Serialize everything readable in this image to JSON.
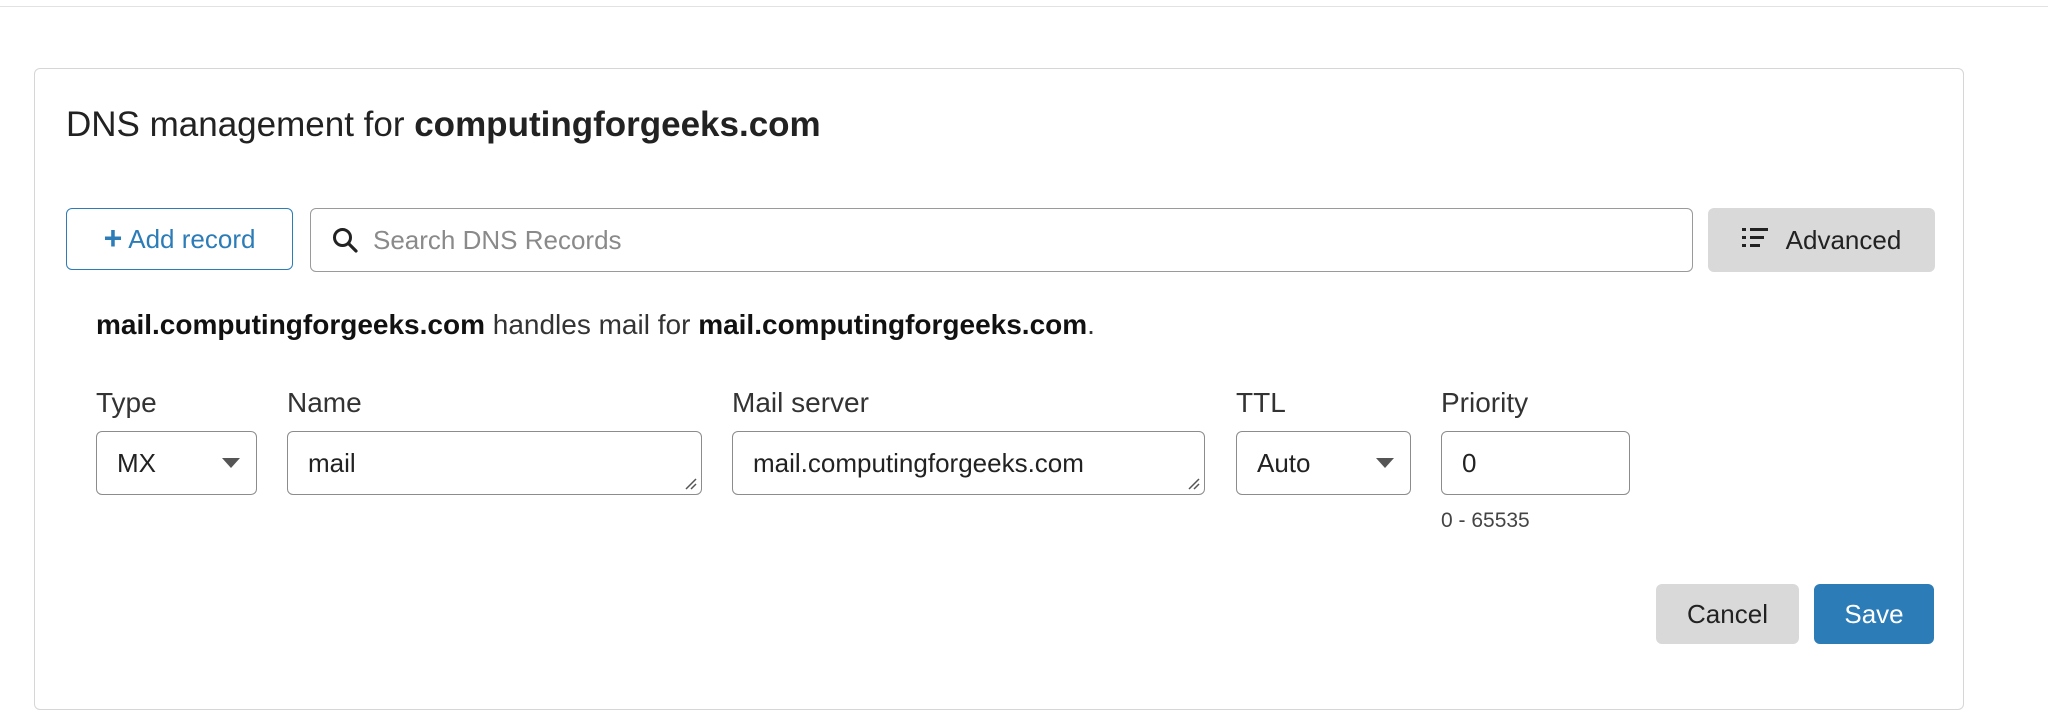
{
  "header": {
    "title_prefix": "DNS management for",
    "domain": "computingforgeeks.com"
  },
  "toolbar": {
    "add_record_label": "Add record",
    "search_placeholder": "Search DNS Records",
    "advanced_label": "Advanced"
  },
  "description": {
    "mail_host": "mail.computingforgeeks.com",
    "middle_text": "handles mail for",
    "target_domain": "mail.computingforgeeks.com",
    "end": "."
  },
  "form": {
    "type": {
      "label": "Type",
      "value": "MX"
    },
    "name": {
      "label": "Name",
      "value": "mail"
    },
    "mail_server": {
      "label": "Mail server",
      "value": "mail.computingforgeeks.com"
    },
    "ttl": {
      "label": "TTL",
      "value": "Auto"
    },
    "priority": {
      "label": "Priority",
      "value": "0",
      "hint": "0 - 65535"
    }
  },
  "actions": {
    "cancel_label": "Cancel",
    "save_label": "Save"
  },
  "colors": {
    "accent": "#2c7cb8",
    "secondary_button": "#d9d9d9"
  },
  "icons": {
    "add": "plus-icon",
    "search": "search-icon",
    "advanced": "list-icon",
    "dropdown": "chevron-down-icon",
    "resize": "resize-handle-icon"
  }
}
